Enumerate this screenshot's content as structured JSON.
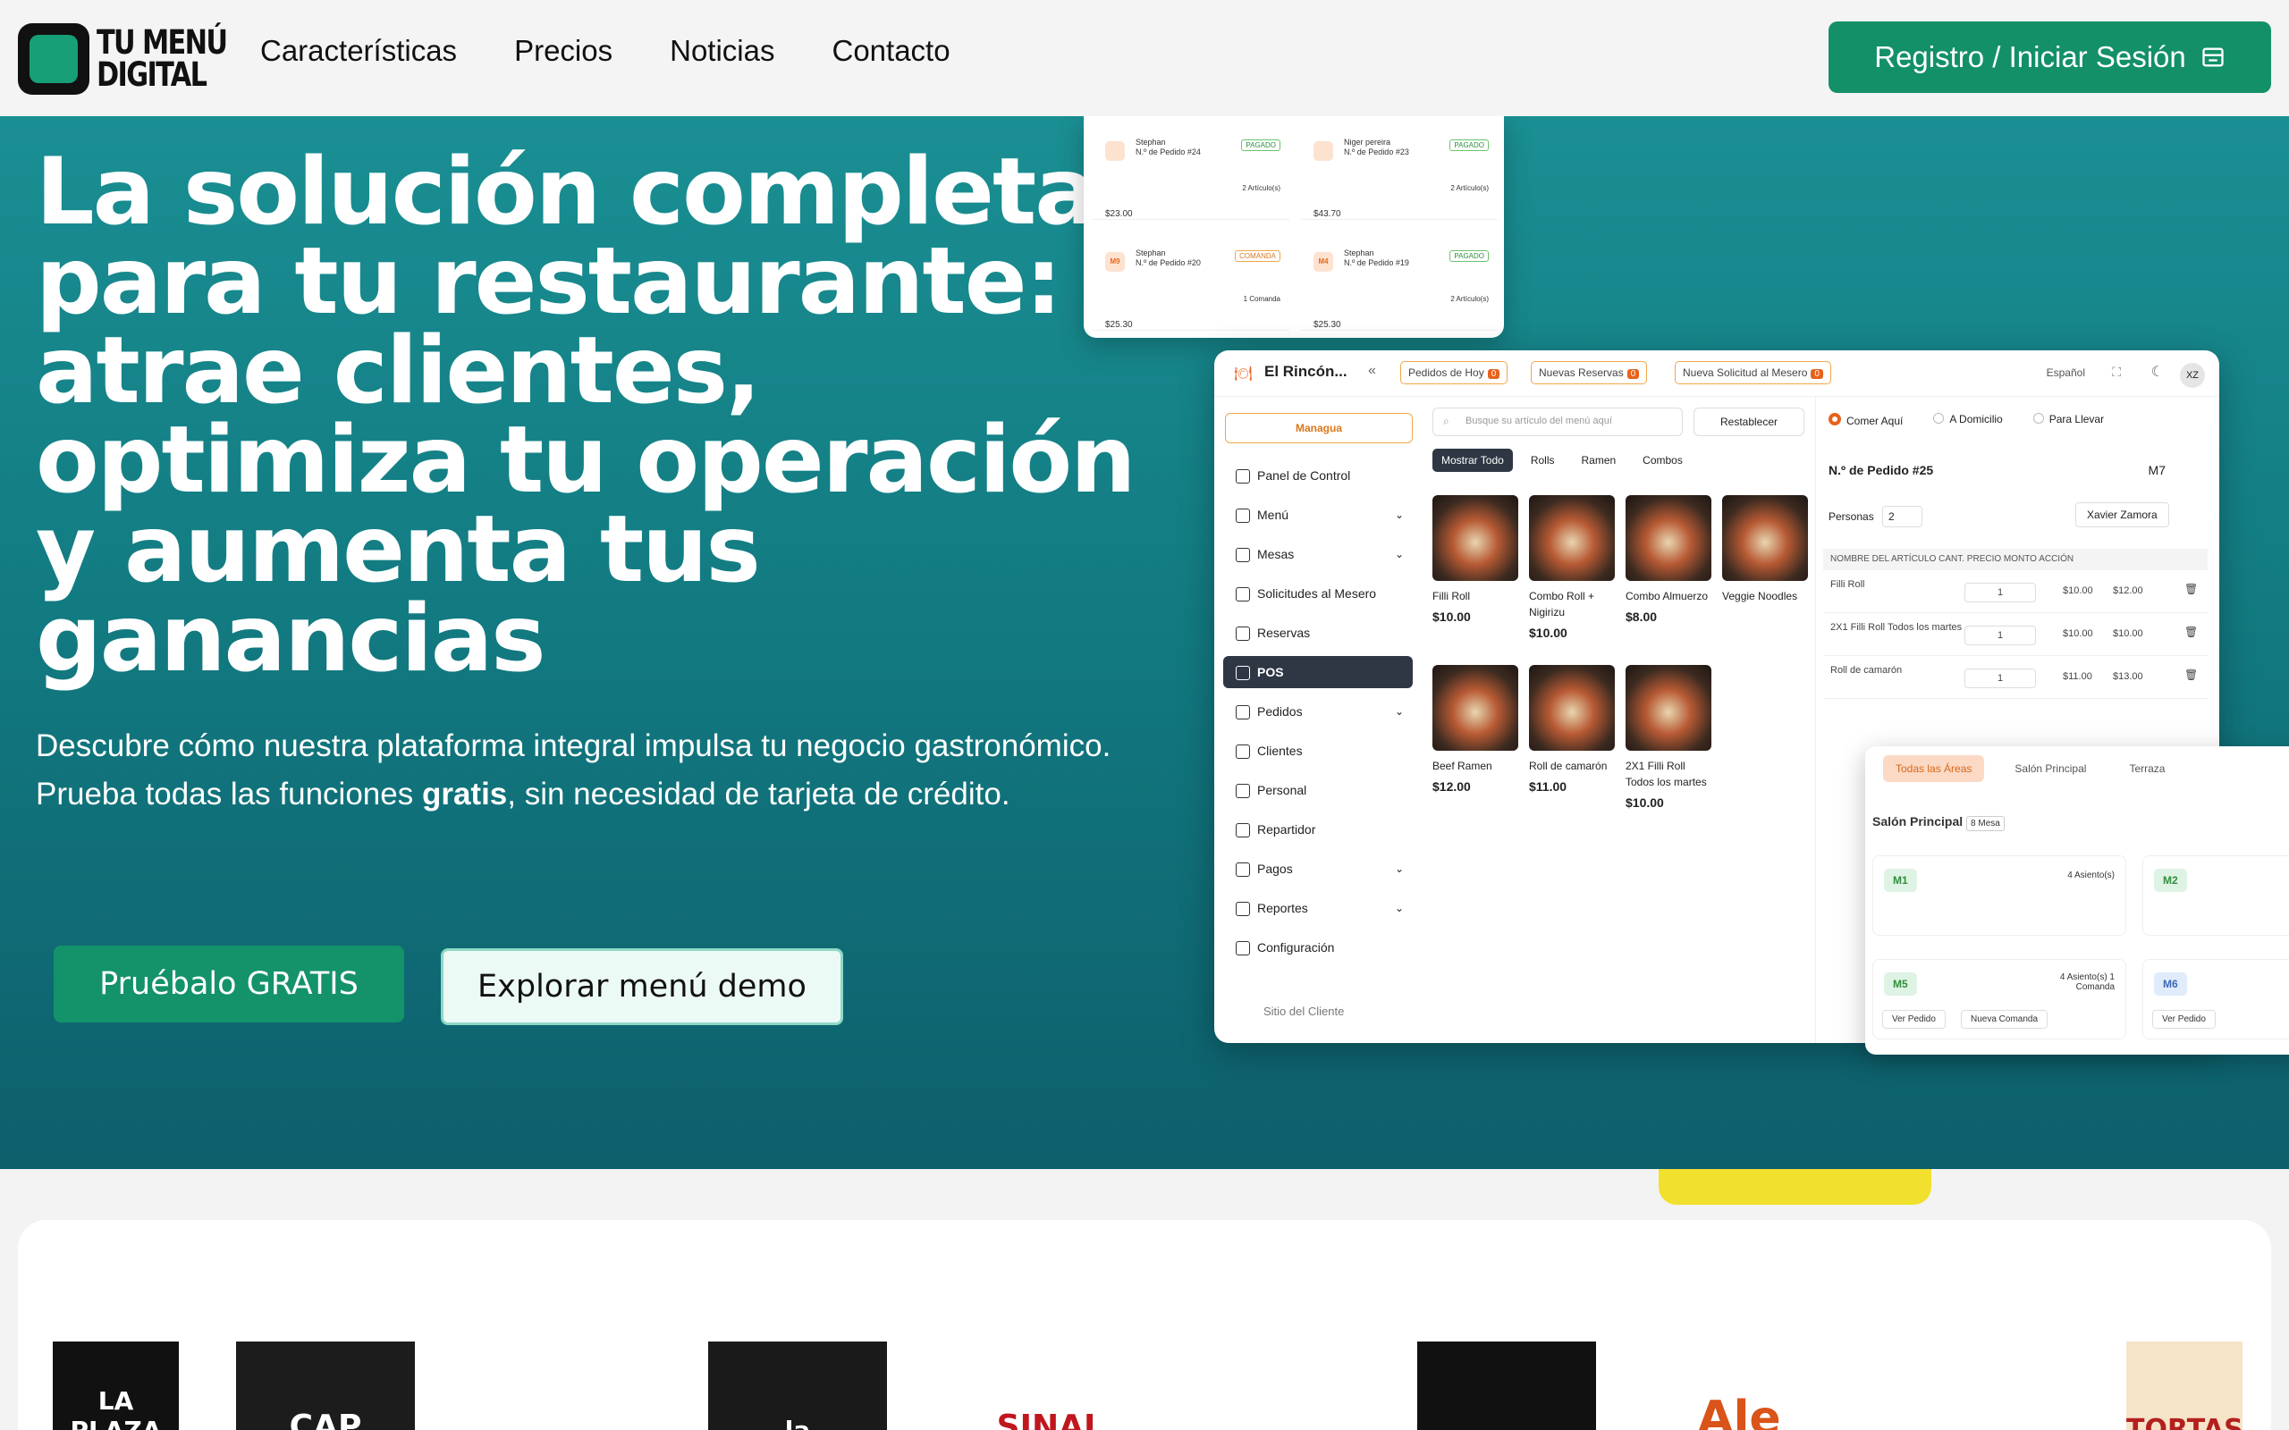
{
  "nav": {
    "logo_line1": "TU MENÚ",
    "logo_line2": "DIGITAL",
    "links": [
      "Características",
      "Precios",
      "Noticias",
      "Contacto"
    ],
    "register_label": "Registro / Iniciar Sesión"
  },
  "hero": {
    "title": "La solución completa para tu restaurante: atrae clientes, optimiza tu operación y aumenta tus ganancias",
    "subtitle_before": "Descubre cómo nuestra plataforma integral impulsa tu negocio gastronómico. Prueba todas las funciones ",
    "subtitle_bold": "gratis",
    "subtitle_after": ", sin necesidad de tarjeta de crédito.",
    "btn_free": "Pruébalo GRATIS",
    "btn_demo": "Explorar menú demo"
  },
  "orders": [
    {
      "icon": "",
      "name": "Stephan",
      "num": "N.º de Pedido #24",
      "status": "PAGADO",
      "items": "2 Artículo(s)",
      "total": "$23.00",
      "tone": "green"
    },
    {
      "icon": "",
      "name": "Niger pereira",
      "num": "N.º de Pedido #23",
      "status": "PAGADO",
      "items": "2 Artículo(s)",
      "total": "$43.70",
      "tone": "green"
    },
    {
      "icon": "M9",
      "name": "Stephan",
      "num": "N.º de Pedido #20",
      "status": "COMANDA",
      "items": "1 Comanda",
      "total": "$25.30",
      "tone": "orange"
    },
    {
      "icon": "M4",
      "name": "Stephan",
      "num": "N.º de Pedido #19",
      "status": "PAGADO",
      "items": "2 Artículo(s)",
      "total": "$25.30",
      "tone": "green"
    }
  ],
  "app": {
    "name": "El Rincón...",
    "pills": [
      {
        "label": "Pedidos de Hoy",
        "count": "0"
      },
      {
        "label": "Nuevas Reservas",
        "count": "0"
      },
      {
        "label": "Nueva Solicitud al Mesero",
        "count": "0"
      }
    ],
    "lang": "Español",
    "avatar": "XZ",
    "location": "Managua",
    "sidebar": [
      "Panel de Control",
      "Menú",
      "Mesas",
      "Solicitudes al Mesero",
      "Reservas",
      "POS",
      "Pedidos",
      "Clientes",
      "Personal",
      "Repartidor",
      "Pagos",
      "Reportes",
      "Configuración"
    ],
    "sidebar_footer": "Sitio del Cliente",
    "search_placeholder": "Busque su artículo del menú aquí",
    "reset": "Restablecer",
    "categories": [
      "Mostrar Todo",
      "Rolls",
      "Ramen",
      "Combos"
    ],
    "products": [
      {
        "name": "Filli Roll",
        "price": "$10.00"
      },
      {
        "name": "Combo Roll + Nigirizu",
        "price": "$10.00"
      },
      {
        "name": "Combo Almuerzo",
        "price": "$8.00"
      },
      {
        "name": "Veggie Noodles",
        "price": ""
      },
      {
        "name": "Beef Ramen",
        "price": "$12.00"
      },
      {
        "name": "Roll de camarón",
        "price": "$11.00"
      },
      {
        "name": "2X1 Filli Roll Todos los martes",
        "price": "$10.00"
      }
    ],
    "order_types": [
      "Comer Aquí",
      "A Domicilio",
      "Para Llevar"
    ],
    "order_no": "N.º de Pedido #25",
    "table": "M7",
    "persons_label": "Personas",
    "persons": "2",
    "waiter": "Xavier Zamora",
    "cart_header": "Nombre del artículo   Cant.   Precio   Monto   Acción",
    "cart": [
      {
        "name": "Filli Roll",
        "qty": "1",
        "price": "$10.00",
        "amount": "$12.00"
      },
      {
        "name": "2X1 Filli Roll Todos los martes",
        "qty": "1",
        "price": "$10.00",
        "amount": "$10.00"
      },
      {
        "name": "Roll de camarón",
        "qty": "1",
        "price": "$11.00",
        "amount": "$13.00"
      }
    ]
  },
  "tables_panel": {
    "tabs": [
      "Todas las Áreas",
      "Salón Principal",
      "Terraza"
    ],
    "title": "Salón Principal",
    "count": "8 Mesa",
    "cards": [
      {
        "tag": "M1",
        "seats": "4 Asiento(s)"
      },
      {
        "tag": "M2",
        "seats": ""
      },
      {
        "tag": "M5",
        "seats": "4 Asiento(s) 1 Comanda"
      },
      {
        "tag": "M6",
        "seats": ""
      }
    ],
    "view_order": "Ver Pedido",
    "new_order": "Nueva Comanda"
  },
  "clients": [
    {
      "label": "LA PLAZA"
    },
    {
      "label": "CAP"
    },
    {
      "label": ""
    },
    {
      "label": "la"
    },
    {
      "label": "SINAI"
    },
    {
      "label": ""
    },
    {
      "label": ""
    },
    {
      "label": "Ale"
    },
    {
      "label": ""
    },
    {
      "label": "TORTAS"
    }
  ],
  "colors": {
    "brand": "#139068",
    "accent": "#e8611a",
    "hero_top": "#1a8f93",
    "hero_bottom": "#0d5f6c"
  }
}
